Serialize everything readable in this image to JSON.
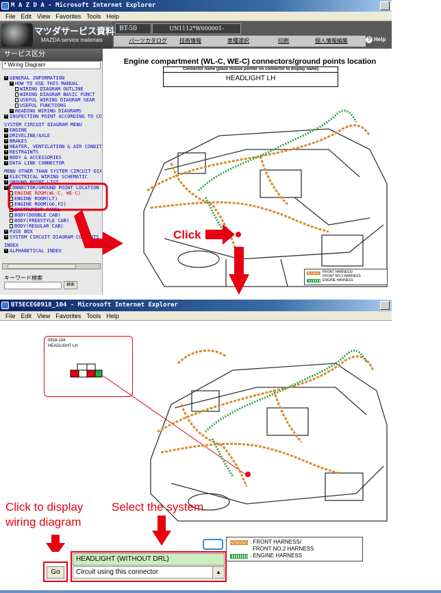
{
  "window1": {
    "title": "M A Z D A - Microsoft Internet Explorer",
    "menu": [
      "File",
      "Edit",
      "View",
      "Favorites",
      "Tools",
      "Help"
    ],
    "header": {
      "brand": "マツダサービス資料",
      "brand_sub": "MAZDA service materials",
      "model": "BT-50",
      "vin": "UN1112*W600001-",
      "nav": [
        "パーツカタログ",
        "技術情報",
        "車種選択",
        "印刷",
        "個人情報編集"
      ],
      "help": "Help"
    },
    "sidebar": {
      "heading": "サービス区分",
      "selected": "* Wiring Diagram",
      "tree": [
        {
          "type": "pm",
          "text": "GENERAL INFORMATION",
          "indent": 0
        },
        {
          "type": "pm",
          "text": "HOW TO USE THIS MANUAL",
          "indent": 1
        },
        {
          "type": "doc",
          "text": "WIRING DIAGRAM OUTLINE",
          "indent": 2
        },
        {
          "type": "doc",
          "text": "WIRING DIAGRAM BASIC FUNCT",
          "indent": 2
        },
        {
          "type": "doc",
          "text": "USEFUL WIRING DIAGRAM SEAR",
          "indent": 2
        },
        {
          "type": "doc",
          "text": "USEFUL FUNCTIONS",
          "indent": 2
        },
        {
          "type": "pm",
          "text": "READING WIRING DIAGRAMS",
          "indent": 1
        },
        {
          "type": "pm",
          "text": "INSPECTION POINT ACCORDING TO CO",
          "indent": 0
        },
        {
          "type": "sec",
          "text": "SYSTEM CIRCUIT DIAGRAM MENU",
          "indent": 0
        },
        {
          "type": "pm",
          "text": "ENGINE",
          "indent": 0
        },
        {
          "type": "pm",
          "text": "DRIVELINE/AXLE",
          "indent": 0
        },
        {
          "type": "pm",
          "text": "BRAKES",
          "indent": 0
        },
        {
          "type": "pm",
          "text": "HEATER, VENTILATION & AIR CONDITI",
          "indent": 0
        },
        {
          "type": "pm",
          "text": "RESTRAINTS",
          "indent": 0
        },
        {
          "type": "pm",
          "text": "BODY & ACCESSORIES",
          "indent": 0
        },
        {
          "type": "pm",
          "text": "DATA LINK CONNECTOR",
          "indent": 0
        },
        {
          "type": "sec",
          "text": "MENU OTHER THAN SYSTEM CIRCUIT DIA",
          "indent": 0
        },
        {
          "type": "pm",
          "text": "ELECTRICAL WIRING SCHEMATIC",
          "indent": 0
        },
        {
          "type": "pm",
          "text": "GROUND POINT LIST",
          "indent": 0
        },
        {
          "type": "pm",
          "text": "CONNECTOR/GROUND POINT LOCATION",
          "indent": 0
        },
        {
          "type": "doc",
          "text": "ENGINE ROOM(WL-C, WE-C)",
          "indent": 1,
          "red": true
        },
        {
          "type": "doc",
          "text": "ENGINE ROOM(LT)",
          "indent": 1
        },
        {
          "type": "doc",
          "text": "ENGINE ROOM(G6,F2)",
          "indent": 1
        },
        {
          "type": "doc",
          "text": "INSTRUMENT PANEL",
          "indent": 1
        },
        {
          "type": "doc",
          "text": "BODY(DOUBLE CAB)",
          "indent": 1
        },
        {
          "type": "doc",
          "text": "BODY(FREESTYLE CAB)",
          "indent": 1
        },
        {
          "type": "doc",
          "text": "BODY(REGULAR CAB)",
          "indent": 1
        },
        {
          "type": "pm",
          "text": "FUSE BOX",
          "indent": 0
        },
        {
          "type": "pm",
          "text": "SYSTEM CIRCUIT DIAGRAM CONTENTS",
          "indent": 0
        },
        {
          "type": "sec",
          "text": "INDEX",
          "indent": 0
        },
        {
          "type": "pm",
          "text": "ALPHABETICAL INDEX",
          "indent": 0
        }
      ],
      "keyword_label": "キーワード検索",
      "keyword_button": "検索"
    },
    "main": {
      "title": "Engine compartment (WL-C, WE-C) connectors/ground points location",
      "connector_header": "Connector name (place mouse pointer on connector to display name)",
      "connector_name": "HEADLIGHT LH",
      "click_label": "Click",
      "legend": [
        {
          "label": "FRONT HARNESS/",
          "label2": "FRONT NO.2 HARNESS",
          "color": "#d98a2b"
        },
        {
          "label": "ENGINE HARNESS",
          "color": "#2aa84a"
        }
      ]
    }
  },
  "window2": {
    "title": "BT5ECEG0918_104 - Microsoft Internet Explorer",
    "menu": [
      "File",
      "Edit",
      "View",
      "Favorites",
      "Tools",
      "Help"
    ],
    "popup": {
      "code": "0918-104",
      "name": "HEADLIGHT LH"
    },
    "hint_display": [
      "Click to display",
      "wiring diagram"
    ],
    "hint_select": "Select the system",
    "selected_system": "HEADLIGHT (WITHOUT DRL)",
    "dropdown_value": "Circuit using this connector",
    "go_button": "Go",
    "legend": [
      {
        "label": ": FRONT HARNESS/",
        "label2": "FRONT NO.2 HARNESS",
        "color": "#d98a2b"
      },
      {
        "label": ": ENGINE HARNESS",
        "color": "#2aa84a"
      }
    ]
  }
}
